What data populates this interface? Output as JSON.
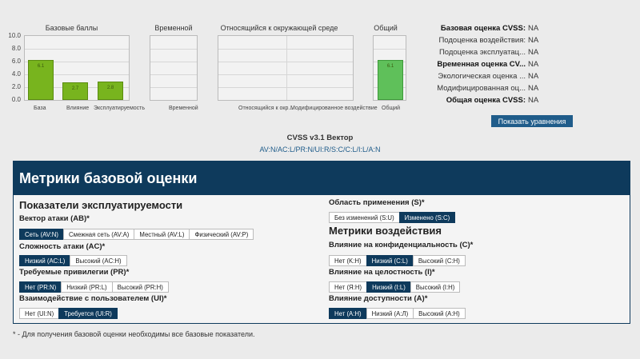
{
  "chart_data": [
    {
      "type": "bar",
      "title": "Базовые баллы",
      "categories": [
        "База",
        "Влияние",
        "Эксплуатируемость"
      ],
      "values": [
        6.1,
        2.7,
        2.8
      ],
      "ylim": [
        0,
        10
      ],
      "yticks": [
        "10.0",
        "8.0",
        "6.0",
        "4.0",
        "2.0",
        "0.0"
      ]
    },
    {
      "type": "bar",
      "title": "Временной",
      "categories": [
        "Временной"
      ],
      "values": [
        null
      ],
      "ylim": [
        0,
        10
      ]
    },
    {
      "type": "bar",
      "title": "Относящийся к окружающей среде",
      "categories": [
        "Относящийся к окр...",
        "Модифицированное воздействие"
      ],
      "values": [
        null,
        null
      ],
      "ylim": [
        0,
        10
      ]
    },
    {
      "type": "bar",
      "title": "Общий",
      "categories": [
        "Общий"
      ],
      "values": [
        6.1
      ],
      "ylim": [
        0,
        10
      ]
    }
  ],
  "labels": {
    "bar_base": "6.1",
    "bar_impact": "2.7",
    "bar_exploit": "2.8",
    "bar_overall": "6.1",
    "yt10": "10.0",
    "yt8": "8.0",
    "yt6": "6.0",
    "yt4": "4.0",
    "yt2": "2.0",
    "yt0": "0.0",
    "x_base": "База",
    "x_impact": "Влияние",
    "x_exploit": "Эксплуатируемость",
    "x_temporal": "Временной",
    "x_env1": "Относящийся к окр...",
    "x_env2": "Модифицированное воздействие",
    "x_overall": "Общий"
  },
  "scores": [
    {
      "label": "Базовая оценка CVSS:",
      "value": "NA",
      "bold": true
    },
    {
      "label": "Подоценка воздействия:",
      "value": "NA",
      "bold": false
    },
    {
      "label": "Подоценка эксплуатац...",
      "value": "NA",
      "bold": false
    },
    {
      "label": "Временная оценка CV...",
      "value": "NA",
      "bold": true
    },
    {
      "label": "Экологическая оценка ...",
      "value": "NA",
      "bold": false
    },
    {
      "label": "Модифицированная оц...",
      "value": "NA",
      "bold": false
    },
    {
      "label": "Общая оценка CVSS:",
      "value": "NA",
      "bold": true
    }
  ],
  "show_equations_label": "Показать уравнения",
  "vector_title": "CVSS v3.1 Вектор",
  "vector_string": "AV:N/AC:L/PR:N/UI:R/S:C/C:L/I:L/A:N",
  "metrics_title": "Метрики базовой оценки",
  "exploitability_heading": "Показатели эксплуатируемости",
  "impact_heading": "Метрики воздействия",
  "metrics": {
    "av": {
      "label": "Вектор атаки (AB)*",
      "options": [
        "Сеть (AV:N)",
        "Смежная сеть (AV:A)",
        "Местный (AV:L)",
        "Физический (AV:P)"
      ],
      "selected": 0
    },
    "ac": {
      "label": "Сложность атаки (AC)*",
      "options": [
        "Низкий (AC:L)",
        "Высокий (AC:H)"
      ],
      "selected": 0
    },
    "pr": {
      "label": "Требуемые привилегии (PR)*",
      "options": [
        "Нет (PR:N)",
        "Низкий (PR:L)",
        "Высокий (PR:H)"
      ],
      "selected": 0
    },
    "ui": {
      "label": "Взаимодействие с пользователем (UI)*",
      "options": [
        "Нет (UI:N)",
        "Требуется (UI:R)"
      ],
      "selected": 1
    },
    "s": {
      "label": "Область применения (S)*",
      "options": [
        "Без изменений (S:U)",
        "Изменено (S:C)"
      ],
      "selected": 1
    },
    "c": {
      "label": "Влияние на конфиденциальность (C)*",
      "options": [
        "Нет (K:H)",
        "Низкий (C:L)",
        "Высокий (C:H)"
      ],
      "selected": 1
    },
    "i": {
      "label": "Влияние на целостность (I)*",
      "options": [
        "Нет (Я:H)",
        "Низкий (I:L)",
        "Высокий (I:H)"
      ],
      "selected": 1
    },
    "a": {
      "label": "Влияние доступности (A)*",
      "options": [
        "Нет (A:H)",
        "Низкий (A:Л)",
        "Высокий (A:H)"
      ],
      "selected": 0
    }
  },
  "footnote": "* - Для получения базовой оценки необходимы все базовые показатели."
}
